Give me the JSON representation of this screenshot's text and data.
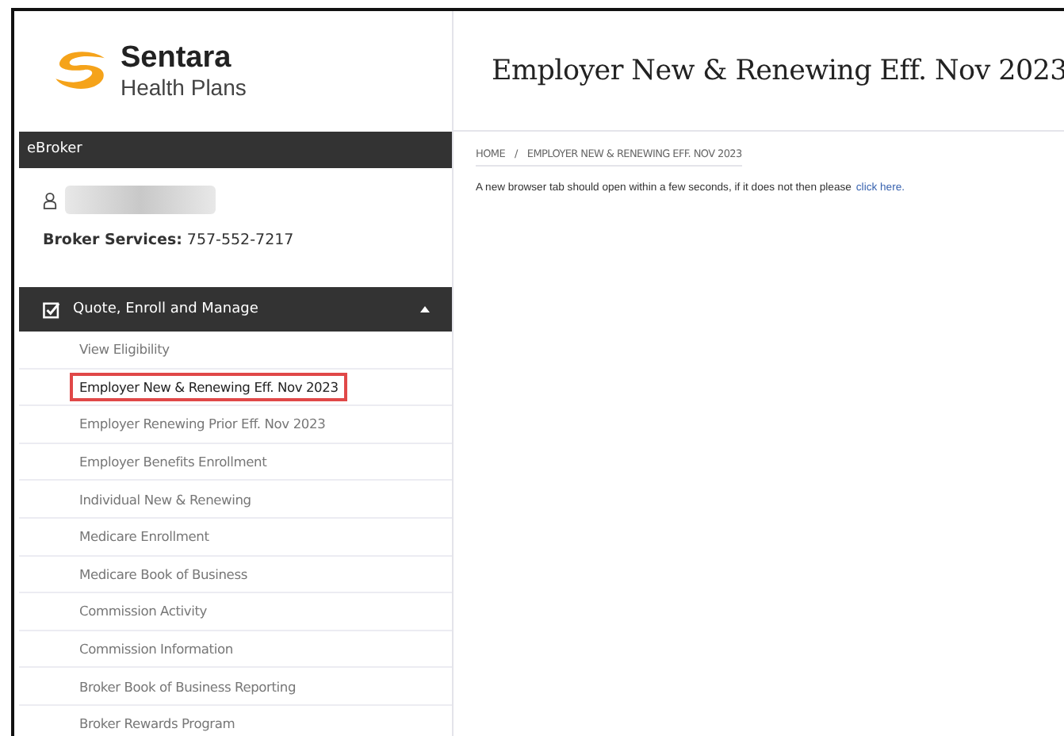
{
  "logo": {
    "name": "Sentara",
    "subtitle": "Health Plans"
  },
  "sidebar": {
    "header": "eBroker",
    "user": {
      "name_redacted": true
    },
    "broker_services": {
      "label": "Broker Services:",
      "phone": "757-552-7217"
    },
    "menu": {
      "label": "Quote, Enroll and Manage",
      "checked": true,
      "expanded": true,
      "items": [
        {
          "label": "View Eligibility",
          "selected": false
        },
        {
          "label": "Employer New & Renewing Eff. Nov 2023",
          "selected": true
        },
        {
          "label": "Employer Renewing Prior Eff. Nov 2023",
          "selected": false
        },
        {
          "label": "Employer Benefits Enrollment",
          "selected": false
        },
        {
          "label": "Individual New & Renewing",
          "selected": false
        },
        {
          "label": "Medicare Enrollment",
          "selected": false
        },
        {
          "label": "Medicare Book of Business",
          "selected": false
        },
        {
          "label": "Commission Activity",
          "selected": false
        },
        {
          "label": "Commission Information",
          "selected": false
        },
        {
          "label": "Broker Book of Business Reporting",
          "selected": false
        },
        {
          "label": "Broker Rewards Program",
          "selected": false
        }
      ]
    }
  },
  "main": {
    "title": "Employer New & Renewing Eff. Nov 2023",
    "breadcrumb": [
      "HOME",
      "EMPLOYER NEW & RENEWING EFF. NOV 2023"
    ],
    "breadcrumb_separator": "/",
    "message": "A new browser tab should open within a few seconds, if it does not then please",
    "link": "click here."
  }
}
